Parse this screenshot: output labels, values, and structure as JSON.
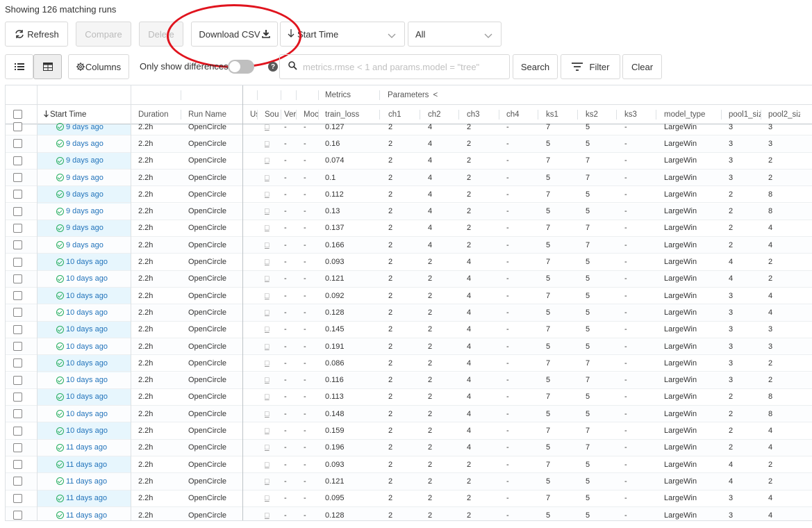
{
  "header": {
    "matching_text": "Showing 126 matching runs"
  },
  "toolbar": {
    "refresh_label": "Refresh",
    "compare_label": "Compare",
    "delete_label": "Delete",
    "download_label": "Download CSV",
    "sort_label": "Start Time",
    "filter_select_label": "All",
    "columns_label": "Columns",
    "only_diff_label": "Only show differences",
    "search_placeholder": "metrics.rmse < 1 and params.model = \"tree\"",
    "search_label": "Search",
    "filter_label": "Filter",
    "clear_label": "Clear"
  },
  "grid": {
    "group_headers": {
      "metrics": "Metrics",
      "parameters": "Parameters",
      "collapse_icon": "<"
    },
    "columns": {
      "start_time": "Start Time",
      "duration": "Duration",
      "run_name": "Run Name",
      "user": "Us",
      "source": "Sou",
      "version": "Ver",
      "models": "Moc",
      "train_loss": "train_loss",
      "ch1": "ch1",
      "ch2": "ch2",
      "ch3": "ch3",
      "ch4": "ch4",
      "ks1": "ks1",
      "ks2": "ks2",
      "ks3": "ks3",
      "model_type": "model_type",
      "pool1": "pool1_siz",
      "pool2": "pool2_siz"
    },
    "rows": [
      {
        "t": "9 days ago",
        "d": "2.2h",
        "n": "OpenCircle",
        "s": "□",
        "v": "-",
        "m": "-",
        "l": "0.127",
        "c1": "2",
        "c2": "4",
        "c3": "2",
        "c4": "-",
        "k1": "7",
        "k2": "5",
        "k3": "-",
        "mt": "LargeWin",
        "p1": "3",
        "p2": "3"
      },
      {
        "t": "9 days ago",
        "d": "2.2h",
        "n": "OpenCircle",
        "s": "□",
        "v": "-",
        "m": "-",
        "l": "0.16",
        "c1": "2",
        "c2": "4",
        "c3": "2",
        "c4": "-",
        "k1": "5",
        "k2": "5",
        "k3": "-",
        "mt": "LargeWin",
        "p1": "3",
        "p2": "3"
      },
      {
        "t": "9 days ago",
        "d": "2.2h",
        "n": "OpenCircle",
        "s": "□",
        "v": "-",
        "m": "-",
        "l": "0.074",
        "c1": "2",
        "c2": "4",
        "c3": "2",
        "c4": "-",
        "k1": "7",
        "k2": "7",
        "k3": "-",
        "mt": "LargeWin",
        "p1": "3",
        "p2": "2"
      },
      {
        "t": "9 days ago",
        "d": "2.2h",
        "n": "OpenCircle",
        "s": "□",
        "v": "-",
        "m": "-",
        "l": "0.1",
        "c1": "2",
        "c2": "4",
        "c3": "2",
        "c4": "-",
        "k1": "5",
        "k2": "7",
        "k3": "-",
        "mt": "LargeWin",
        "p1": "3",
        "p2": "2"
      },
      {
        "t": "9 days ago",
        "d": "2.2h",
        "n": "OpenCircle",
        "s": "□",
        "v": "-",
        "m": "-",
        "l": "0.112",
        "c1": "2",
        "c2": "4",
        "c3": "2",
        "c4": "-",
        "k1": "7",
        "k2": "5",
        "k3": "-",
        "mt": "LargeWin",
        "p1": "2",
        "p2": "8"
      },
      {
        "t": "9 days ago",
        "d": "2.2h",
        "n": "OpenCircle",
        "s": "□",
        "v": "-",
        "m": "-",
        "l": "0.13",
        "c1": "2",
        "c2": "4",
        "c3": "2",
        "c4": "-",
        "k1": "5",
        "k2": "5",
        "k3": "-",
        "mt": "LargeWin",
        "p1": "2",
        "p2": "8"
      },
      {
        "t": "9 days ago",
        "d": "2.2h",
        "n": "OpenCircle",
        "s": "□",
        "v": "-",
        "m": "-",
        "l": "0.137",
        "c1": "2",
        "c2": "4",
        "c3": "2",
        "c4": "-",
        "k1": "7",
        "k2": "7",
        "k3": "-",
        "mt": "LargeWin",
        "p1": "2",
        "p2": "4"
      },
      {
        "t": "9 days ago",
        "d": "2.2h",
        "n": "OpenCircle",
        "s": "□",
        "v": "-",
        "m": "-",
        "l": "0.166",
        "c1": "2",
        "c2": "4",
        "c3": "2",
        "c4": "-",
        "k1": "5",
        "k2": "7",
        "k3": "-",
        "mt": "LargeWin",
        "p1": "2",
        "p2": "4"
      },
      {
        "t": "10 days ago",
        "d": "2.2h",
        "n": "OpenCircle",
        "s": "□",
        "v": "-",
        "m": "-",
        "l": "0.093",
        "c1": "2",
        "c2": "2",
        "c3": "4",
        "c4": "-",
        "k1": "7",
        "k2": "5",
        "k3": "-",
        "mt": "LargeWin",
        "p1": "4",
        "p2": "2"
      },
      {
        "t": "10 days ago",
        "d": "2.2h",
        "n": "OpenCircle",
        "s": "□",
        "v": "-",
        "m": "-",
        "l": "0.121",
        "c1": "2",
        "c2": "2",
        "c3": "4",
        "c4": "-",
        "k1": "5",
        "k2": "5",
        "k3": "-",
        "mt": "LargeWin",
        "p1": "4",
        "p2": "2"
      },
      {
        "t": "10 days ago",
        "d": "2.2h",
        "n": "OpenCircle",
        "s": "□",
        "v": "-",
        "m": "-",
        "l": "0.092",
        "c1": "2",
        "c2": "2",
        "c3": "4",
        "c4": "-",
        "k1": "7",
        "k2": "5",
        "k3": "-",
        "mt": "LargeWin",
        "p1": "3",
        "p2": "4"
      },
      {
        "t": "10 days ago",
        "d": "2.2h",
        "n": "OpenCircle",
        "s": "□",
        "v": "-",
        "m": "-",
        "l": "0.128",
        "c1": "2",
        "c2": "2",
        "c3": "4",
        "c4": "-",
        "k1": "5",
        "k2": "5",
        "k3": "-",
        "mt": "LargeWin",
        "p1": "3",
        "p2": "4"
      },
      {
        "t": "10 days ago",
        "d": "2.2h",
        "n": "OpenCircle",
        "s": "□",
        "v": "-",
        "m": "-",
        "l": "0.145",
        "c1": "2",
        "c2": "2",
        "c3": "4",
        "c4": "-",
        "k1": "7",
        "k2": "5",
        "k3": "-",
        "mt": "LargeWin",
        "p1": "3",
        "p2": "3"
      },
      {
        "t": "10 days ago",
        "d": "2.2h",
        "n": "OpenCircle",
        "s": "□",
        "v": "-",
        "m": "-",
        "l": "0.191",
        "c1": "2",
        "c2": "2",
        "c3": "4",
        "c4": "-",
        "k1": "5",
        "k2": "5",
        "k3": "-",
        "mt": "LargeWin",
        "p1": "3",
        "p2": "3"
      },
      {
        "t": "10 days ago",
        "d": "2.2h",
        "n": "OpenCircle",
        "s": "□",
        "v": "-",
        "m": "-",
        "l": "0.086",
        "c1": "2",
        "c2": "2",
        "c3": "4",
        "c4": "-",
        "k1": "7",
        "k2": "7",
        "k3": "-",
        "mt": "LargeWin",
        "p1": "3",
        "p2": "2"
      },
      {
        "t": "10 days ago",
        "d": "2.2h",
        "n": "OpenCircle",
        "s": "□",
        "v": "-",
        "m": "-",
        "l": "0.116",
        "c1": "2",
        "c2": "2",
        "c3": "4",
        "c4": "-",
        "k1": "5",
        "k2": "7",
        "k3": "-",
        "mt": "LargeWin",
        "p1": "3",
        "p2": "2"
      },
      {
        "t": "10 days ago",
        "d": "2.2h",
        "n": "OpenCircle",
        "s": "□",
        "v": "-",
        "m": "-",
        "l": "0.113",
        "c1": "2",
        "c2": "2",
        "c3": "4",
        "c4": "-",
        "k1": "7",
        "k2": "5",
        "k3": "-",
        "mt": "LargeWin",
        "p1": "2",
        "p2": "8"
      },
      {
        "t": "10 days ago",
        "d": "2.2h",
        "n": "OpenCircle",
        "s": "□",
        "v": "-",
        "m": "-",
        "l": "0.148",
        "c1": "2",
        "c2": "2",
        "c3": "4",
        "c4": "-",
        "k1": "5",
        "k2": "5",
        "k3": "-",
        "mt": "LargeWin",
        "p1": "2",
        "p2": "8"
      },
      {
        "t": "10 days ago",
        "d": "2.2h",
        "n": "OpenCircle",
        "s": "□",
        "v": "-",
        "m": "-",
        "l": "0.159",
        "c1": "2",
        "c2": "2",
        "c3": "4",
        "c4": "-",
        "k1": "7",
        "k2": "7",
        "k3": "-",
        "mt": "LargeWin",
        "p1": "2",
        "p2": "4"
      },
      {
        "t": "11 days ago",
        "d": "2.2h",
        "n": "OpenCircle",
        "s": "□",
        "v": "-",
        "m": "-",
        "l": "0.196",
        "c1": "2",
        "c2": "2",
        "c3": "4",
        "c4": "-",
        "k1": "5",
        "k2": "7",
        "k3": "-",
        "mt": "LargeWin",
        "p1": "2",
        "p2": "4"
      },
      {
        "t": "11 days ago",
        "d": "2.2h",
        "n": "OpenCircle",
        "s": "□",
        "v": "-",
        "m": "-",
        "l": "0.093",
        "c1": "2",
        "c2": "2",
        "c3": "2",
        "c4": "-",
        "k1": "7",
        "k2": "5",
        "k3": "-",
        "mt": "LargeWin",
        "p1": "4",
        "p2": "2"
      },
      {
        "t": "11 days ago",
        "d": "2.2h",
        "n": "OpenCircle",
        "s": "□",
        "v": "-",
        "m": "-",
        "l": "0.121",
        "c1": "2",
        "c2": "2",
        "c3": "2",
        "c4": "-",
        "k1": "5",
        "k2": "5",
        "k3": "-",
        "mt": "LargeWin",
        "p1": "4",
        "p2": "2"
      },
      {
        "t": "11 days ago",
        "d": "2.2h",
        "n": "OpenCircle",
        "s": "□",
        "v": "-",
        "m": "-",
        "l": "0.095",
        "c1": "2",
        "c2": "2",
        "c3": "2",
        "c4": "-",
        "k1": "7",
        "k2": "5",
        "k3": "-",
        "mt": "LargeWin",
        "p1": "3",
        "p2": "4"
      },
      {
        "t": "11 days ago",
        "d": "2.2h",
        "n": "OpenCircle",
        "s": "□",
        "v": "-",
        "m": "-",
        "l": "0.128",
        "c1": "2",
        "c2": "2",
        "c3": "2",
        "c4": "-",
        "k1": "5",
        "k2": "5",
        "k3": "-",
        "mt": "LargeWin",
        "p1": "3",
        "p2": "4"
      }
    ]
  }
}
